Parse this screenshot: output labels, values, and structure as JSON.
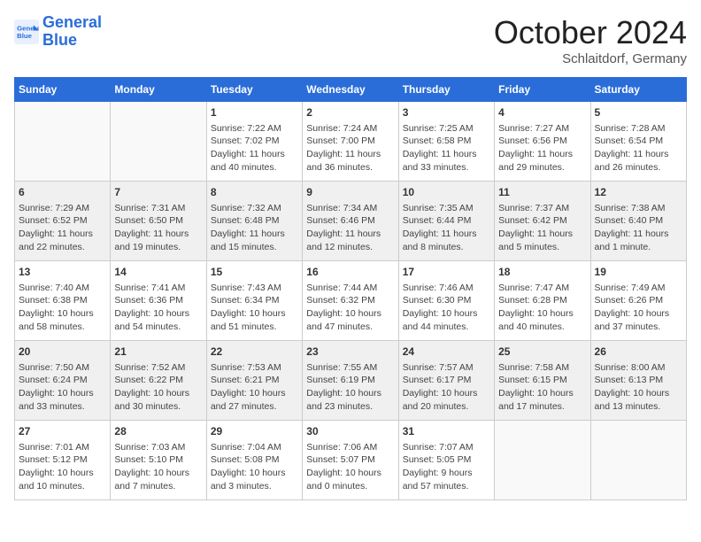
{
  "logo": {
    "line1": "General",
    "line2": "Blue"
  },
  "title": "October 2024",
  "location": "Schlaitdorf, Germany",
  "days_header": [
    "Sunday",
    "Monday",
    "Tuesday",
    "Wednesday",
    "Thursday",
    "Friday",
    "Saturday"
  ],
  "weeks": [
    [
      {
        "day": "",
        "info": ""
      },
      {
        "day": "",
        "info": ""
      },
      {
        "day": "1",
        "info": "Sunrise: 7:22 AM\nSunset: 7:02 PM\nDaylight: 11 hours\nand 40 minutes."
      },
      {
        "day": "2",
        "info": "Sunrise: 7:24 AM\nSunset: 7:00 PM\nDaylight: 11 hours\nand 36 minutes."
      },
      {
        "day": "3",
        "info": "Sunrise: 7:25 AM\nSunset: 6:58 PM\nDaylight: 11 hours\nand 33 minutes."
      },
      {
        "day": "4",
        "info": "Sunrise: 7:27 AM\nSunset: 6:56 PM\nDaylight: 11 hours\nand 29 minutes."
      },
      {
        "day": "5",
        "info": "Sunrise: 7:28 AM\nSunset: 6:54 PM\nDaylight: 11 hours\nand 26 minutes."
      }
    ],
    [
      {
        "day": "6",
        "info": "Sunrise: 7:29 AM\nSunset: 6:52 PM\nDaylight: 11 hours\nand 22 minutes."
      },
      {
        "day": "7",
        "info": "Sunrise: 7:31 AM\nSunset: 6:50 PM\nDaylight: 11 hours\nand 19 minutes."
      },
      {
        "day": "8",
        "info": "Sunrise: 7:32 AM\nSunset: 6:48 PM\nDaylight: 11 hours\nand 15 minutes."
      },
      {
        "day": "9",
        "info": "Sunrise: 7:34 AM\nSunset: 6:46 PM\nDaylight: 11 hours\nand 12 minutes."
      },
      {
        "day": "10",
        "info": "Sunrise: 7:35 AM\nSunset: 6:44 PM\nDaylight: 11 hours\nand 8 minutes."
      },
      {
        "day": "11",
        "info": "Sunrise: 7:37 AM\nSunset: 6:42 PM\nDaylight: 11 hours\nand 5 minutes."
      },
      {
        "day": "12",
        "info": "Sunrise: 7:38 AM\nSunset: 6:40 PM\nDaylight: 11 hours\nand 1 minute."
      }
    ],
    [
      {
        "day": "13",
        "info": "Sunrise: 7:40 AM\nSunset: 6:38 PM\nDaylight: 10 hours\nand 58 minutes."
      },
      {
        "day": "14",
        "info": "Sunrise: 7:41 AM\nSunset: 6:36 PM\nDaylight: 10 hours\nand 54 minutes."
      },
      {
        "day": "15",
        "info": "Sunrise: 7:43 AM\nSunset: 6:34 PM\nDaylight: 10 hours\nand 51 minutes."
      },
      {
        "day": "16",
        "info": "Sunrise: 7:44 AM\nSunset: 6:32 PM\nDaylight: 10 hours\nand 47 minutes."
      },
      {
        "day": "17",
        "info": "Sunrise: 7:46 AM\nSunset: 6:30 PM\nDaylight: 10 hours\nand 44 minutes."
      },
      {
        "day": "18",
        "info": "Sunrise: 7:47 AM\nSunset: 6:28 PM\nDaylight: 10 hours\nand 40 minutes."
      },
      {
        "day": "19",
        "info": "Sunrise: 7:49 AM\nSunset: 6:26 PM\nDaylight: 10 hours\nand 37 minutes."
      }
    ],
    [
      {
        "day": "20",
        "info": "Sunrise: 7:50 AM\nSunset: 6:24 PM\nDaylight: 10 hours\nand 33 minutes."
      },
      {
        "day": "21",
        "info": "Sunrise: 7:52 AM\nSunset: 6:22 PM\nDaylight: 10 hours\nand 30 minutes."
      },
      {
        "day": "22",
        "info": "Sunrise: 7:53 AM\nSunset: 6:21 PM\nDaylight: 10 hours\nand 27 minutes."
      },
      {
        "day": "23",
        "info": "Sunrise: 7:55 AM\nSunset: 6:19 PM\nDaylight: 10 hours\nand 23 minutes."
      },
      {
        "day": "24",
        "info": "Sunrise: 7:57 AM\nSunset: 6:17 PM\nDaylight: 10 hours\nand 20 minutes."
      },
      {
        "day": "25",
        "info": "Sunrise: 7:58 AM\nSunset: 6:15 PM\nDaylight: 10 hours\nand 17 minutes."
      },
      {
        "day": "26",
        "info": "Sunrise: 8:00 AM\nSunset: 6:13 PM\nDaylight: 10 hours\nand 13 minutes."
      }
    ],
    [
      {
        "day": "27",
        "info": "Sunrise: 7:01 AM\nSunset: 5:12 PM\nDaylight: 10 hours\nand 10 minutes."
      },
      {
        "day": "28",
        "info": "Sunrise: 7:03 AM\nSunset: 5:10 PM\nDaylight: 10 hours\nand 7 minutes."
      },
      {
        "day": "29",
        "info": "Sunrise: 7:04 AM\nSunset: 5:08 PM\nDaylight: 10 hours\nand 3 minutes."
      },
      {
        "day": "30",
        "info": "Sunrise: 7:06 AM\nSunset: 5:07 PM\nDaylight: 10 hours\nand 0 minutes."
      },
      {
        "day": "31",
        "info": "Sunrise: 7:07 AM\nSunset: 5:05 PM\nDaylight: 9 hours\nand 57 minutes."
      },
      {
        "day": "",
        "info": ""
      },
      {
        "day": "",
        "info": ""
      }
    ]
  ]
}
